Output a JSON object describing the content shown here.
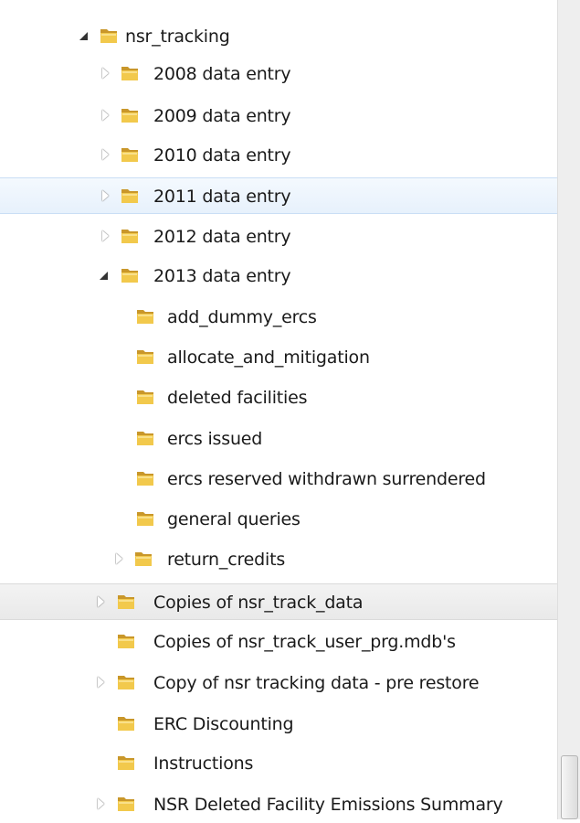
{
  "tree": {
    "items": [
      {
        "label": "nsr_tracking",
        "state": "expanded",
        "icon": "folder-icon"
      },
      {
        "label": "2008 data entry",
        "state": "collapsed",
        "icon": "folder-icon"
      },
      {
        "label": "2009 data entry",
        "state": "collapsed",
        "icon": "folder-icon"
      },
      {
        "label": "2010 data entry",
        "state": "collapsed",
        "icon": "folder-icon"
      },
      {
        "label": "2011 data entry",
        "state": "collapsed",
        "icon": "folder-icon",
        "selected": true
      },
      {
        "label": "2012 data entry",
        "state": "collapsed",
        "icon": "folder-icon"
      },
      {
        "label": "2013 data entry",
        "state": "expanded",
        "icon": "folder-icon"
      },
      {
        "label": "add_dummy_ercs",
        "state": "leaf",
        "icon": "folder-icon"
      },
      {
        "label": "allocate_and_mitigation",
        "state": "leaf",
        "icon": "folder-icon"
      },
      {
        "label": "deleted facilities",
        "state": "leaf",
        "icon": "folder-icon"
      },
      {
        "label": "ercs issued",
        "state": "leaf",
        "icon": "folder-icon"
      },
      {
        "label": "ercs reserved withdrawn surrendered",
        "state": "leaf",
        "icon": "folder-icon"
      },
      {
        "label": "general queries",
        "state": "leaf",
        "icon": "folder-icon"
      },
      {
        "label": "return_credits",
        "state": "collapsed",
        "icon": "folder-icon"
      },
      {
        "label": "Copies of nsr_track_data",
        "state": "collapsed",
        "icon": "folder-icon",
        "hovered": true
      },
      {
        "label": "Copies of nsr_track_user_prg.mdb's",
        "state": "leaf",
        "icon": "folder-icon"
      },
      {
        "label": "Copy of nsr tracking data  - pre restore",
        "state": "collapsed",
        "icon": "folder-icon"
      },
      {
        "label": "ERC Discounting",
        "state": "leaf",
        "icon": "folder-icon"
      },
      {
        "label": "Instructions",
        "state": "leaf",
        "icon": "folder-icon"
      },
      {
        "label": "NSR Deleted Facility Emissions Summary",
        "state": "collapsed",
        "icon": "folder-icon"
      }
    ]
  },
  "colors": {
    "selected_background": "#e7f1fc",
    "hover_background": "#ececec",
    "folder_yellow": "#f2c94c",
    "folder_dark": "#c9972a"
  }
}
